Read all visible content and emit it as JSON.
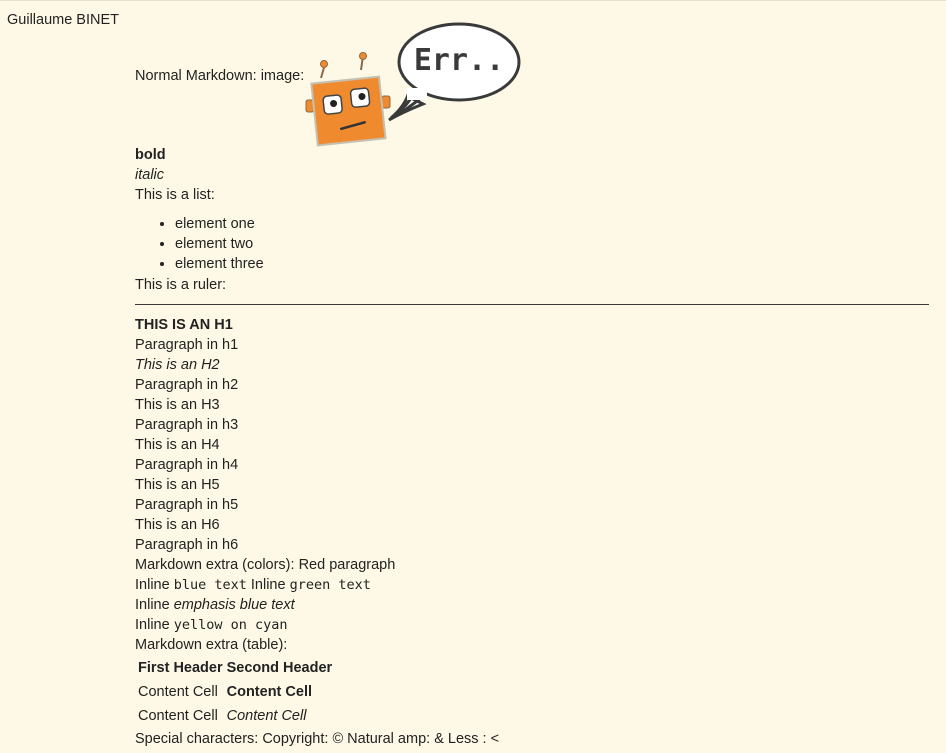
{
  "author": "Guillaume BINET",
  "image_line": {
    "label": "Normal Markdown: image:",
    "speech_text": "Err.."
  },
  "bold": "bold",
  "italic": "italic",
  "list_intro": "This is a list:",
  "list_items": [
    "element one",
    "element two",
    "element three"
  ],
  "ruler_intro": "This is a ruler:",
  "headings": {
    "h1": "THIS IS AN H1",
    "p_h1": "Paragraph in h1",
    "h2": "This is an H2",
    "p_h2": "Paragraph in h2",
    "h3": "This is an H3",
    "p_h3": "Paragraph in h3",
    "h4": "This is an H4",
    "p_h4": "Paragraph in h4",
    "h5": "This is an H5",
    "p_h5": "Paragraph in h5",
    "h6": "This is an H6",
    "p_h6": "Paragraph in h6"
  },
  "colors_line": {
    "label": "Markdown extra (colors):",
    "red_text": "Red paragraph"
  },
  "inline_line1": {
    "prefix1": "Inline",
    "blue_code": "blue text",
    "prefix2": "Inline",
    "green_code": "green text"
  },
  "inline_line2": {
    "prefix": "Inline",
    "emphasis": "emphasis blue text"
  },
  "inline_line3": {
    "prefix": "Inline",
    "code": "yellow on cyan"
  },
  "table_intro": "Markdown extra (table):",
  "table": {
    "headers": [
      "First Header",
      "Second Header"
    ],
    "rows": [
      [
        "Content Cell",
        "Content Cell"
      ],
      [
        "Content Cell",
        "Content Cell"
      ]
    ]
  },
  "special": "Special characters: Copyright: © Natural amp: & Less : <",
  "colors": {
    "background": "#fef9e6",
    "text": "#222222",
    "robot_orange": "#f08a2e",
    "robot_outline": "#4a4a4a"
  }
}
